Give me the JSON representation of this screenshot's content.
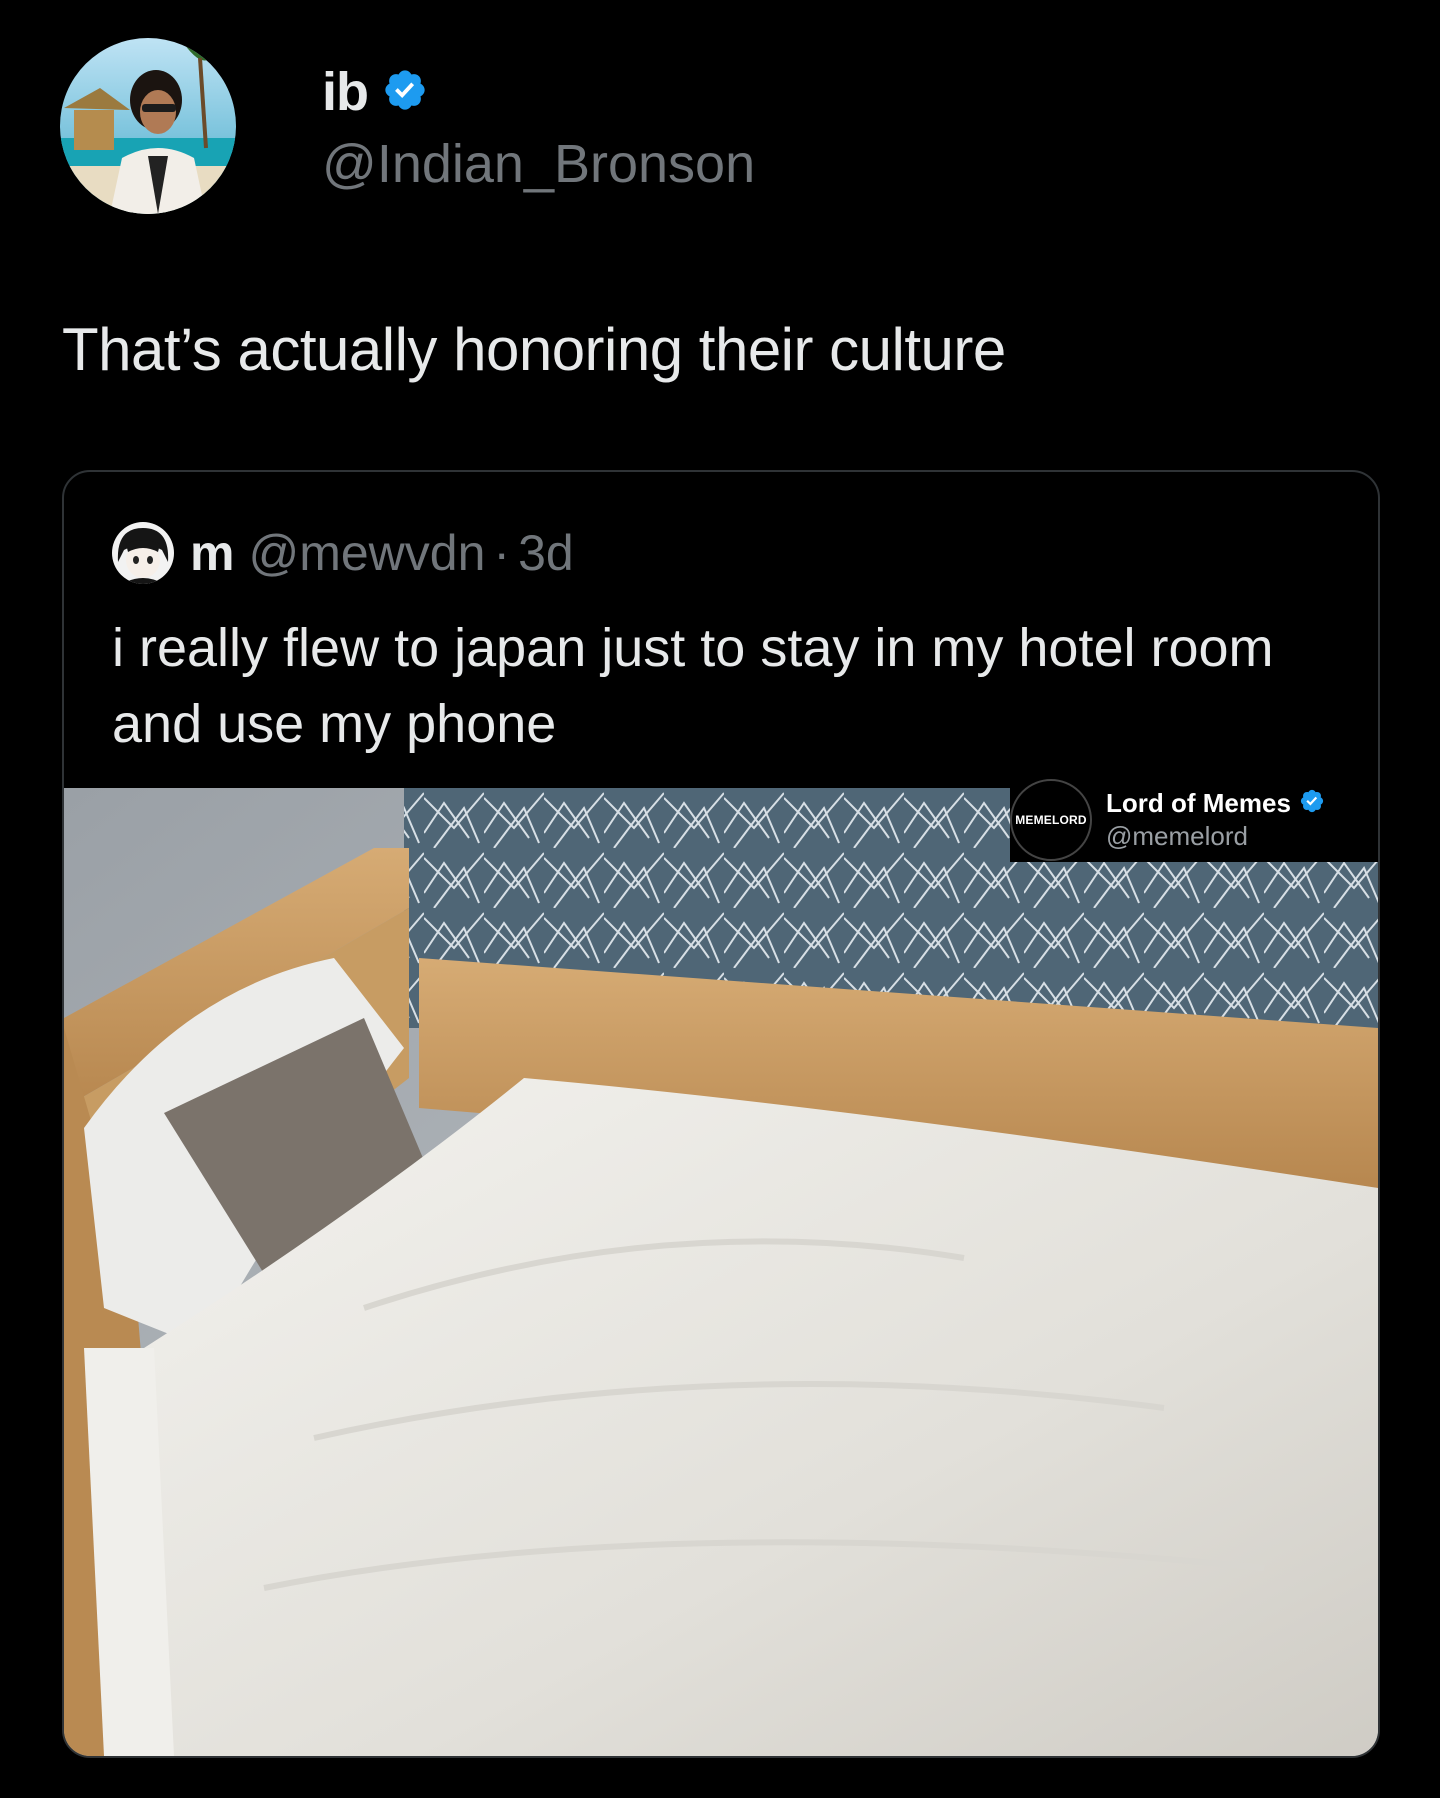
{
  "tweet": {
    "author": {
      "display_name": "ib",
      "handle": "@Indian_Bronson",
      "verified_icon": "verified-badge-icon"
    },
    "text": "That’s actually honoring their culture"
  },
  "quoted_tweet": {
    "author": {
      "display_name": "m",
      "handle": "@mewvdn",
      "separator": "·",
      "time": "3d"
    },
    "text": "i really flew to japan just to stay in my hotel room and use my phone",
    "media_description_icon": "hotel-bed-photo"
  },
  "watermark": {
    "logo_text": "MEMELORD",
    "display_name": "Lord of Memes",
    "handle": "@memelord",
    "verified_icon": "verified-badge-icon"
  },
  "colors": {
    "background": "#000000",
    "primary_text": "#e7e9ea",
    "secondary_text": "#71767b",
    "verified_blue": "#1d9bf0",
    "card_border": "#2f3336"
  }
}
